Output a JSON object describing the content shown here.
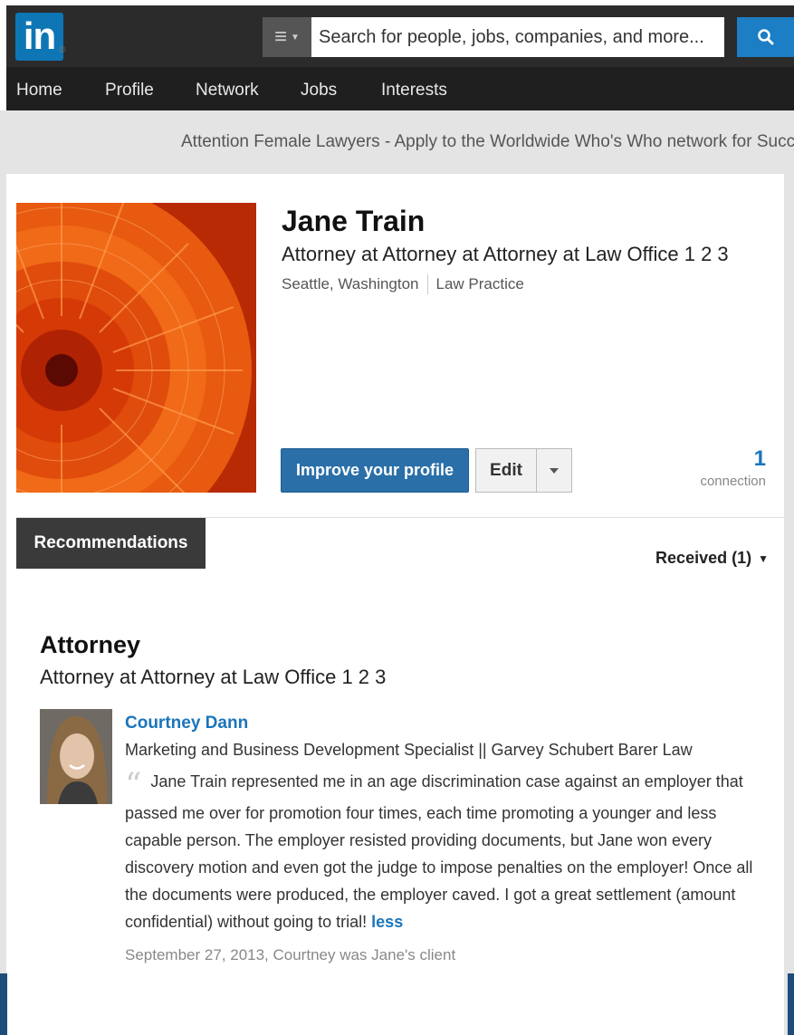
{
  "header": {
    "logo_text": "in",
    "logo_mark": "®",
    "search": {
      "placeholder": "Search for people, jobs, companies, and more..."
    }
  },
  "nav": {
    "items": [
      {
        "label": "Home"
      },
      {
        "label": "Profile"
      },
      {
        "label": "Network"
      },
      {
        "label": "Jobs"
      },
      {
        "label": "Interests"
      }
    ]
  },
  "banner": {
    "text": "Attention Female Lawyers - Apply to the Worldwide Who's Who network for Succe"
  },
  "profile": {
    "name": "Jane Train",
    "headline": "Attorney at Attorney at Attorney at Law Office 1 2 3",
    "location": "Seattle, Washington",
    "industry": "Law Practice",
    "improve_label": "Improve your profile",
    "edit_label": "Edit",
    "connections_count": "1",
    "connections_label": "connection"
  },
  "recommendations": {
    "tab_label": "Recommendations",
    "received_label": "Received (1)",
    "position_title": "Attorney",
    "position_company": "Attorney at Attorney at Law Office 1 2 3",
    "item": {
      "recommender_name": "Courtney Dann",
      "recommender_role": "Marketing and Business Development Specialist || Garvey Schubert Barer Law",
      "quote_mark": "“",
      "text": "Jane Train represented me in an age discrimination case against an employer that passed me over for promotion four times, each time promoting a younger and less capable person. The employer resisted providing documents, but Jane won every discovery motion and even got the judge to impose penalties on the employer! Once all the documents were produced, the employer caved. I got a great settlement (amount confidential) without going to trial!",
      "less_label": "less",
      "date": "September 27, 2013, Courtney was Jane's client"
    }
  },
  "colors": {
    "brand_blue": "#0e76b4",
    "link_blue": "#1a75bb",
    "button_blue": "#2a6fa8",
    "topbar": "#2b2b2b",
    "navbar": "#1f1f1f"
  },
  "icons": {
    "search": "search-icon",
    "menu": "menu-icon",
    "caret": "chevron-down-icon"
  }
}
